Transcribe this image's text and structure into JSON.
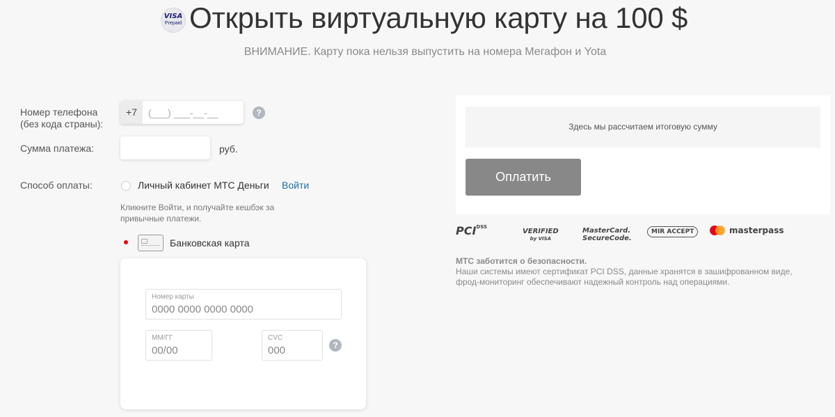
{
  "header": {
    "badge_top": "VISA",
    "badge_bottom": "Prepaid",
    "title": "Открыть виртуальную карту на 100 $",
    "warning": "ВНИМАНИЕ. Карту пока нельзя выпустить на номера Мегафон и Yota"
  },
  "form": {
    "phone_label_1": "Номер телефона",
    "phone_label_2": "(без кода страны):",
    "phone_prefix": "+7",
    "phone_placeholder": "(___) ___-__-__",
    "help_symbol": "?",
    "amount_label": "Сумма платежа:",
    "amount_value": "",
    "currency": "руб.",
    "payment_method_label": "Способ оплаты:",
    "option_wallet": "Личный кабинет МТС Деньги",
    "login_link": "Войти",
    "cashback_text": "Кликните Войти, и получайте кешбэк за привычные платежи.",
    "option_card": "Банковская карта",
    "selected_option": "card"
  },
  "card_form": {
    "number_label": "Номер карты",
    "number_placeholder": "0000 0000 0000 0000",
    "expiry_label": "ММ/ГГ",
    "expiry_placeholder": "00/00",
    "cvc_label": "CVC",
    "cvc_placeholder": "000"
  },
  "summary": {
    "text": "Здесь мы рассчитаем итоговую сумму",
    "pay_button": "Оплатить"
  },
  "logos": {
    "pci": "PCI",
    "pci_sub": "DSS",
    "vbv_top": "VERIFIED",
    "vbv_bottom": "by VISA",
    "mc_line1": "MasterCard.",
    "mc_line2": "SecureCode.",
    "mir": "MIR ACCEPT",
    "masterpass": "masterpass"
  },
  "security": {
    "title": "МТС заботится о безопасности.",
    "text": "Наши системы имеют сертификат PCI DSS, данные хранятся в зашифрованном виде, фрод-мониторинг обеспечивают надежный контроль над операциями."
  },
  "colors": {
    "background": "#f7f7f7",
    "accent_red": "#e30611",
    "link_blue": "#1d6fa5",
    "button_gray": "#888888"
  }
}
